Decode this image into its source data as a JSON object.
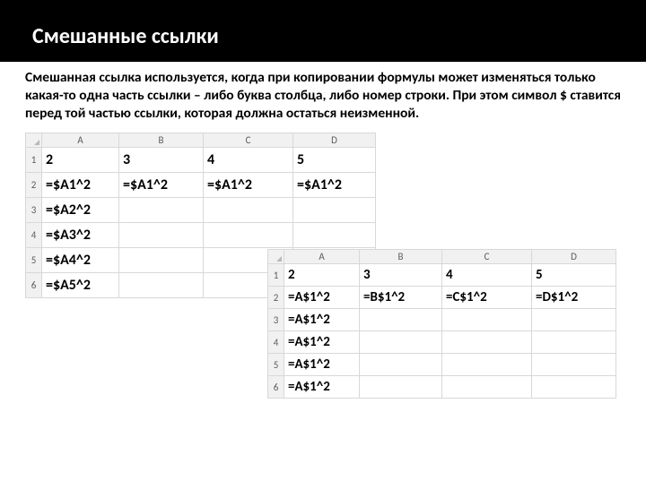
{
  "title": "Смешанные ссылки",
  "paragraph": "Смешанная ссылка используется, когда при копировании формулы может изменяться только какая-то одна часть ссылки – либо буква столбца, либо номер строки. При этом символ $ ставится перед той частью ссылки, которая должна остаться неизменной.",
  "sheet1": {
    "cols": [
      "A",
      "B",
      "C",
      "D"
    ],
    "rows": [
      "1",
      "2",
      "3",
      "4",
      "5",
      "6"
    ],
    "cells": [
      [
        "2",
        "3",
        "4",
        "5"
      ],
      [
        "=$A1^2",
        "=$A1^2",
        "=$A1^2",
        "=$A1^2"
      ],
      [
        "=$A2^2",
        "",
        "",
        ""
      ],
      [
        "=$A3^2",
        "",
        "",
        ""
      ],
      [
        "=$A4^2",
        "",
        "",
        ""
      ],
      [
        "=$A5^2",
        "",
        "",
        ""
      ]
    ]
  },
  "sheet2": {
    "cols": [
      "A",
      "B",
      "C",
      "D"
    ],
    "rows": [
      "1",
      "2",
      "3",
      "4",
      "5",
      "6"
    ],
    "cells": [
      [
        "2",
        "3",
        "4",
        "5"
      ],
      [
        "=A$1^2",
        "=B$1^2",
        "=C$1^2",
        "=D$1^2"
      ],
      [
        "=A$1^2",
        "",
        "",
        ""
      ],
      [
        "=A$1^2",
        "",
        "",
        ""
      ],
      [
        "=A$1^2",
        "",
        "",
        ""
      ],
      [
        "=A$1^2",
        "",
        "",
        ""
      ]
    ]
  }
}
